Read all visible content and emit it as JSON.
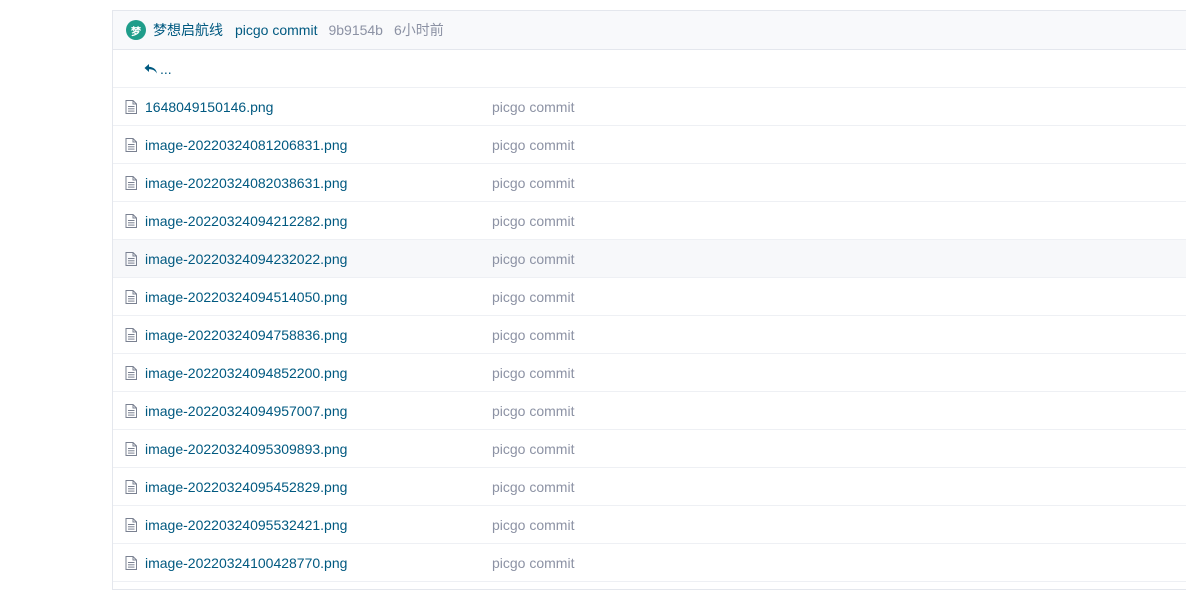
{
  "commit": {
    "avatar_char": "梦",
    "author": "梦想启航线",
    "message": "picgo commit",
    "sha": "9b9154b",
    "time": "6小时前"
  },
  "up_label": "...",
  "files": [
    {
      "name": "1648049150146.png",
      "commit": "picgo commit"
    },
    {
      "name": "image-20220324081206831.png",
      "commit": "picgo commit"
    },
    {
      "name": "image-20220324082038631.png",
      "commit": "picgo commit"
    },
    {
      "name": "image-20220324094212282.png",
      "commit": "picgo commit"
    },
    {
      "name": "image-20220324094232022.png",
      "commit": "picgo commit"
    },
    {
      "name": "image-20220324094514050.png",
      "commit": "picgo commit"
    },
    {
      "name": "image-20220324094758836.png",
      "commit": "picgo commit"
    },
    {
      "name": "image-20220324094852200.png",
      "commit": "picgo commit"
    },
    {
      "name": "image-20220324094957007.png",
      "commit": "picgo commit"
    },
    {
      "name": "image-20220324095309893.png",
      "commit": "picgo commit"
    },
    {
      "name": "image-20220324095452829.png",
      "commit": "picgo commit"
    },
    {
      "name": "image-20220324095532421.png",
      "commit": "picgo commit"
    },
    {
      "name": "image-20220324100428770.png",
      "commit": "picgo commit"
    }
  ],
  "colors": {
    "link": "#005980",
    "muted": "#8c92a4",
    "avatar": "#1f9d8a"
  },
  "icons": {
    "up": "reply-arrow-icon",
    "file": "file-icon"
  }
}
